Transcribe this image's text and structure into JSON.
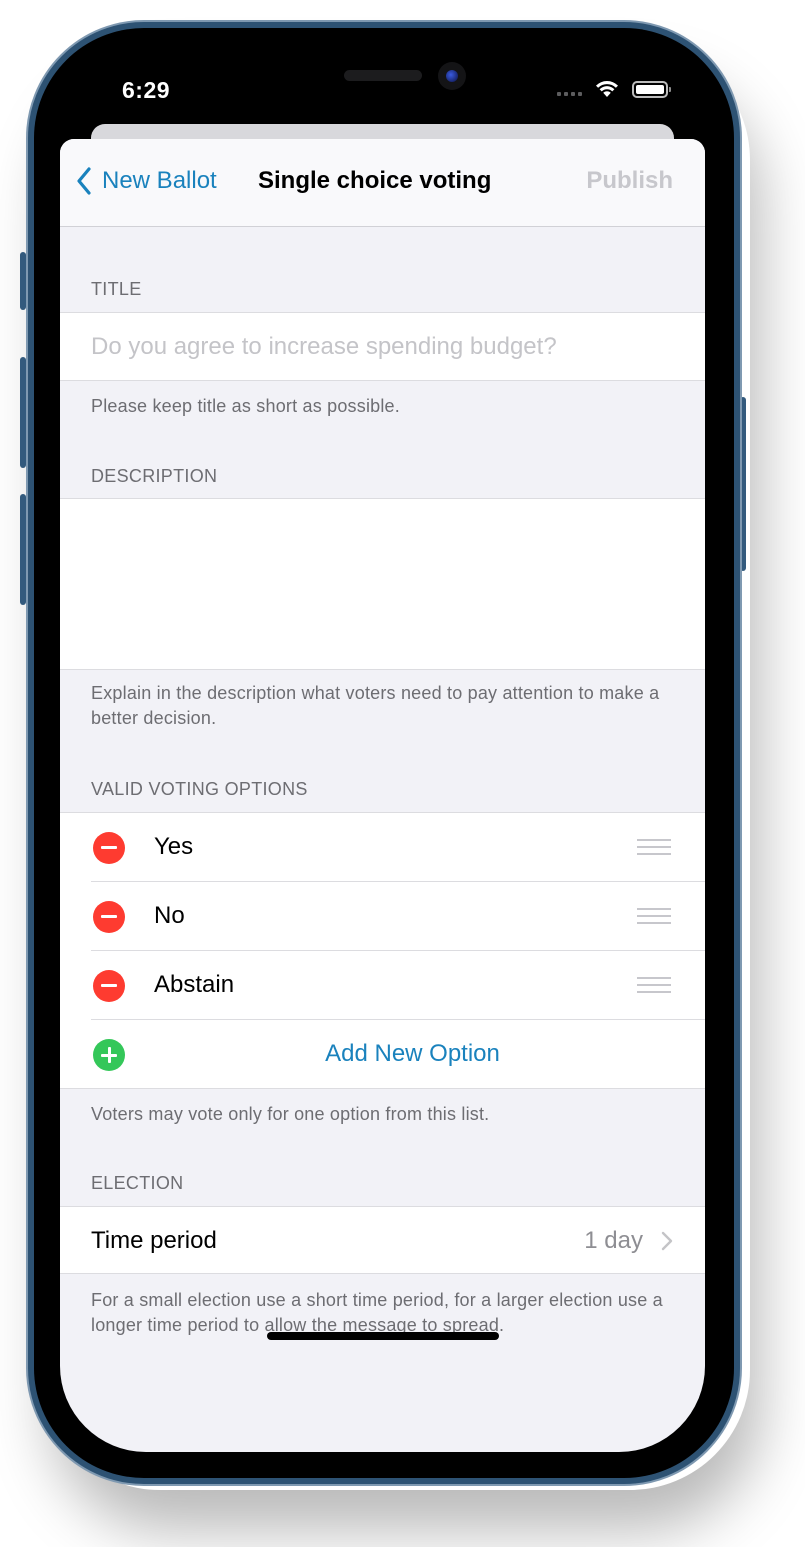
{
  "status_bar": {
    "time": "6:29",
    "icons": [
      "cellular-signal-icon",
      "wifi-icon",
      "battery-icon"
    ]
  },
  "navbar": {
    "back_label": "New Ballot",
    "back_icon": "chevron-left-icon",
    "title": "Single choice voting",
    "publish_label": "Publish",
    "accent_color": "#1a82bd",
    "publish_disabled_color": "#c7c7cc"
  },
  "title_section": {
    "header": "TITLE",
    "input_value": "",
    "input_placeholder": "Do you agree to increase spending budget?",
    "footer": "Please keep title as short as possible."
  },
  "description_section": {
    "header": "DESCRIPTION",
    "input_value": "",
    "footer": "Explain in the description what voters need to pay attention to make a better decision."
  },
  "options_section": {
    "header": "VALID VOTING OPTIONS",
    "options": [
      {
        "label": "Yes",
        "remove_icon": "minus-circle-icon",
        "drag_icon": "reorder-handle-icon"
      },
      {
        "label": "No",
        "remove_icon": "minus-circle-icon",
        "drag_icon": "reorder-handle-icon"
      },
      {
        "label": "Abstain",
        "remove_icon": "minus-circle-icon",
        "drag_icon": "reorder-handle-icon"
      }
    ],
    "add_label": "Add New Option",
    "add_icon": "plus-circle-icon",
    "remove_color": "#fe3b30",
    "add_color": "#34c759",
    "footer": "Voters may vote only for one option from this list."
  },
  "election_section": {
    "header": "ELECTION",
    "time_period_label": "Time period",
    "time_period_value": "1 day",
    "disclosure_icon": "chevron-right-icon",
    "footer": "For a small election use a short time period, for a larger election use a longer time period to allow the message to spread."
  }
}
